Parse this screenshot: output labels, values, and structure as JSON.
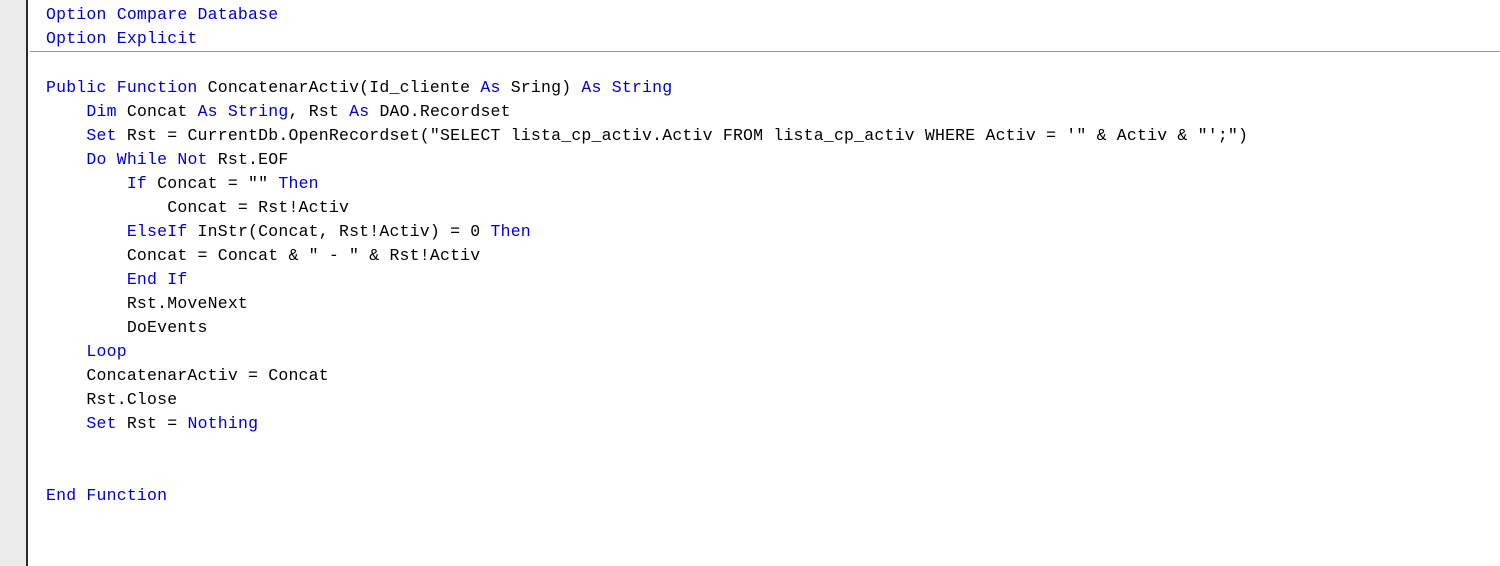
{
  "editor": {
    "name": "vba-code-editor",
    "language": "VBA",
    "colors": {
      "background": "#ffffff",
      "keyword": "#0000cd",
      "text": "#000000",
      "gutter": "#ececec",
      "gutter_border": "#2b2b2b",
      "separator": "#9a9a9a"
    }
  },
  "declarations": {
    "lines": [
      {
        "name": "line-option-compare-database",
        "tokens": [
          {
            "t": "Option Compare Database",
            "k": "kw"
          }
        ]
      },
      {
        "name": "line-option-explicit",
        "tokens": [
          {
            "t": "Option Explicit",
            "k": "kw"
          }
        ]
      }
    ]
  },
  "procedure": {
    "lines": [
      {
        "name": "line-blank-1",
        "tokens": []
      },
      {
        "name": "line-function-signature",
        "tokens": [
          {
            "t": "Public Function ",
            "k": "kw"
          },
          {
            "t": "ConcatenarActiv(Id_cliente ",
            "k": "txt"
          },
          {
            "t": "As ",
            "k": "kw"
          },
          {
            "t": "Sring) ",
            "k": "txt"
          },
          {
            "t": "As ",
            "k": "kw"
          },
          {
            "t": "String",
            "k": "kw"
          }
        ]
      },
      {
        "name": "line-dim-declaration",
        "tokens": [
          {
            "t": "    ",
            "k": "txt"
          },
          {
            "t": "Dim ",
            "k": "kw"
          },
          {
            "t": "Concat ",
            "k": "txt"
          },
          {
            "t": "As ",
            "k": "kw"
          },
          {
            "t": "String",
            "k": "kw"
          },
          {
            "t": ", Rst ",
            "k": "txt"
          },
          {
            "t": "As ",
            "k": "kw"
          },
          {
            "t": "DAO.Recordset",
            "k": "txt"
          }
        ]
      },
      {
        "name": "line-set-recordset",
        "tokens": [
          {
            "t": "    ",
            "k": "txt"
          },
          {
            "t": "Set ",
            "k": "kw"
          },
          {
            "t": "Rst = CurrentDb.OpenRecordset(\"SELECT lista_cp_activ.Activ FROM lista_cp_activ WHERE Activ = '\" & Activ & \"';\")",
            "k": "txt"
          }
        ]
      },
      {
        "name": "line-do-while",
        "tokens": [
          {
            "t": "    ",
            "k": "txt"
          },
          {
            "t": "Do While Not ",
            "k": "kw"
          },
          {
            "t": "Rst.EOF",
            "k": "txt"
          }
        ]
      },
      {
        "name": "line-if-concat-empty",
        "tokens": [
          {
            "t": "        ",
            "k": "txt"
          },
          {
            "t": "If ",
            "k": "kw"
          },
          {
            "t": "Concat = \"\" ",
            "k": "txt"
          },
          {
            "t": "Then",
            "k": "kw"
          }
        ]
      },
      {
        "name": "line-assign-concat-first",
        "tokens": [
          {
            "t": "            Concat = Rst!Activ",
            "k": "txt"
          }
        ]
      },
      {
        "name": "line-elseif-instr",
        "tokens": [
          {
            "t": "        ",
            "k": "txt"
          },
          {
            "t": "ElseIf ",
            "k": "kw"
          },
          {
            "t": "InStr(Concat, Rst!Activ) = 0 ",
            "k": "txt"
          },
          {
            "t": "Then",
            "k": "kw"
          }
        ]
      },
      {
        "name": "line-assign-concat-append",
        "tokens": [
          {
            "t": "        Concat = Concat & \" - \" & Rst!Activ",
            "k": "txt"
          }
        ]
      },
      {
        "name": "line-end-if",
        "tokens": [
          {
            "t": "        ",
            "k": "txt"
          },
          {
            "t": "End If",
            "k": "kw"
          }
        ]
      },
      {
        "name": "line-rst-movenext",
        "tokens": [
          {
            "t": "        Rst.MoveNext",
            "k": "txt"
          }
        ]
      },
      {
        "name": "line-doevents",
        "tokens": [
          {
            "t": "        DoEvents",
            "k": "txt"
          }
        ]
      },
      {
        "name": "line-loop",
        "tokens": [
          {
            "t": "    ",
            "k": "txt"
          },
          {
            "t": "Loop",
            "k": "kw"
          }
        ]
      },
      {
        "name": "line-return-value",
        "tokens": [
          {
            "t": "    ConcatenarActiv = Concat",
            "k": "txt"
          }
        ]
      },
      {
        "name": "line-rst-close",
        "tokens": [
          {
            "t": "    Rst.Close",
            "k": "txt"
          }
        ]
      },
      {
        "name": "line-set-nothing",
        "tokens": [
          {
            "t": "    ",
            "k": "txt"
          },
          {
            "t": "Set ",
            "k": "kw"
          },
          {
            "t": "Rst = ",
            "k": "txt"
          },
          {
            "t": "Nothing",
            "k": "kw"
          }
        ]
      },
      {
        "name": "line-blank-2",
        "tokens": []
      },
      {
        "name": "line-blank-3",
        "tokens": []
      },
      {
        "name": "line-end-function",
        "tokens": [
          {
            "t": "End Function",
            "k": "kw"
          }
        ]
      }
    ]
  }
}
